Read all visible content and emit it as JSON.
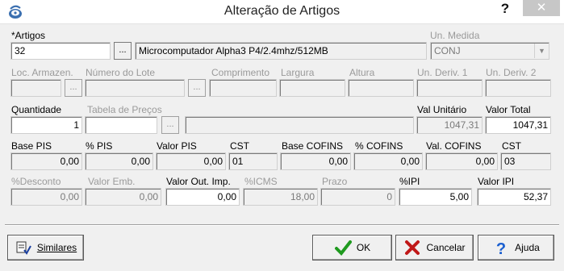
{
  "window": {
    "title": "Alteração de Artigos",
    "help_label": "?",
    "close_label": "✕"
  },
  "icons": {
    "app": "app-swirl-icon",
    "similares": "check-list-icon",
    "ok": "green-check-icon",
    "cancelar": "red-x-icon",
    "ajuda": "question-mark-icon"
  },
  "row1": {
    "artigos_label": "*Artigos",
    "artigos_value": "32",
    "browse_label": "...",
    "description_value": "Microcomputador Alpha3 P4/2.4mhz/512MB",
    "un_medida_label": "Un. Medida",
    "un_medida_value": "CONJ"
  },
  "row2": {
    "loc_armazen_label": "Loc. Armazen.",
    "numero_lote_label": "Número do Lote",
    "comprimento_label": "Comprimento",
    "largura_label": "Largura",
    "altura_label": "Altura",
    "un_deriv1_label": "Un. Deriv. 1",
    "un_deriv2_label": "Un. Deriv. 2",
    "browse_label": "..."
  },
  "row3": {
    "quantidade_label": "Quantidade",
    "quantidade_value": "1",
    "tabela_precos_label": "Tabela de Preços",
    "browse_label": "...",
    "val_unitario_label": "Val Unitário",
    "val_unitario_value": "1047,31",
    "valor_total_label": "Valor Total",
    "valor_total_value": "1047,31"
  },
  "row4": {
    "base_pis_label": "Base PIS",
    "base_pis_value": "0,00",
    "pct_pis_label": "% PIS",
    "pct_pis_value": "0,00",
    "valor_pis_label": "Valor PIS",
    "valor_pis_value": "0,00",
    "cst1_label": "CST",
    "cst1_value": "01",
    "base_cofins_label": "Base COFINS",
    "base_cofins_value": "0,00",
    "pct_cofins_label": "% COFINS",
    "pct_cofins_value": "0,00",
    "val_cofins_label": "Val. COFINS",
    "val_cofins_value": "0,00",
    "cst2_label": "CST",
    "cst2_value": "03"
  },
  "row5": {
    "desconto_label": "%Desconto",
    "desconto_value": "0,00",
    "valor_emb_label": "Valor Emb.",
    "valor_emb_value": "0,00",
    "valor_out_imp_label": "Valor Out. Imp.",
    "valor_out_imp_value": "0,00",
    "icms_label": "%ICMS",
    "icms_value": "18,00",
    "prazo_label": "Prazo",
    "prazo_value": "0",
    "ipi_label": "%IPI",
    "ipi_value": "5,00",
    "valor_ipi_label": "Valor IPI",
    "valor_ipi_value": "52,37"
  },
  "buttons": {
    "similares": "Similares",
    "ok": "OK",
    "cancelar": "Cancelar",
    "ajuda": "Ajuda"
  },
  "colors": {
    "ok_check": "#1f9a1f",
    "cancel_x": "#c01818",
    "help_q": "#1a5fd0"
  }
}
